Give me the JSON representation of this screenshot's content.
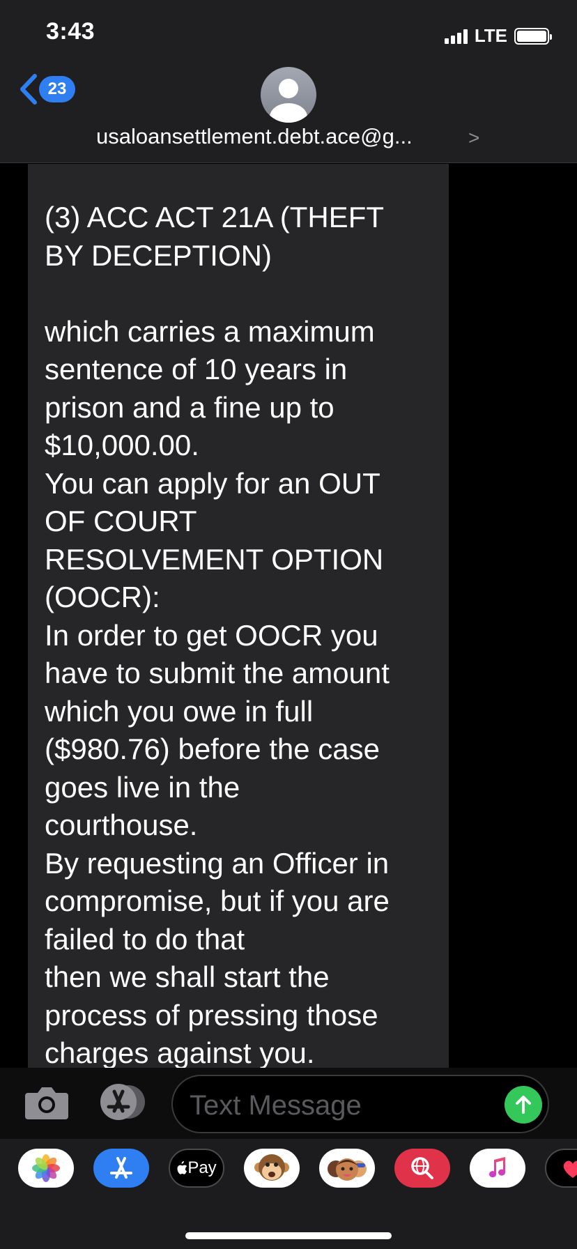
{
  "status_bar": {
    "time": "3:43",
    "network": "LTE"
  },
  "header": {
    "back_badge_count": "23",
    "contact_name": "usaloansettlement.debt.ace@g...",
    "contact_chevron": ">"
  },
  "message": {
    "paragraphs": [
      "(3) ACC ACT 21A (THEFT\nBY DECEPTION)",
      "",
      "which carries a maximum\nsentence of 10 years in\nprison and a fine up to\n$10,000.00.\nYou can apply for an OUT\nOF COURT\nRESOLVEMENT OPTION\n(OOCR):\nIn order to get OOCR you\nhave to submit the amount\nwhich you owe in full\n($980.76) before the case\ngoes live in the\ncourthouse.\nBy requesting an Officer in\ncompromise, but if you are\nfailed to do that\nthen we shall start the\nprocess of pressing those\ncharges against you."
    ]
  },
  "input_bar": {
    "placeholder": "Text Message"
  },
  "app_drawer": {
    "apple_pay_label": "Pay",
    "apps": [
      "photos-icon",
      "app-store-icon",
      "apple-pay-icon",
      "animoji-icon",
      "memoji-icon",
      "image-search-icon",
      "music-icon",
      "digital-touch-icon"
    ]
  },
  "colors": {
    "accent_blue": "#2f7ff2",
    "send_green": "#34c759",
    "bubble_gray": "#262628"
  }
}
